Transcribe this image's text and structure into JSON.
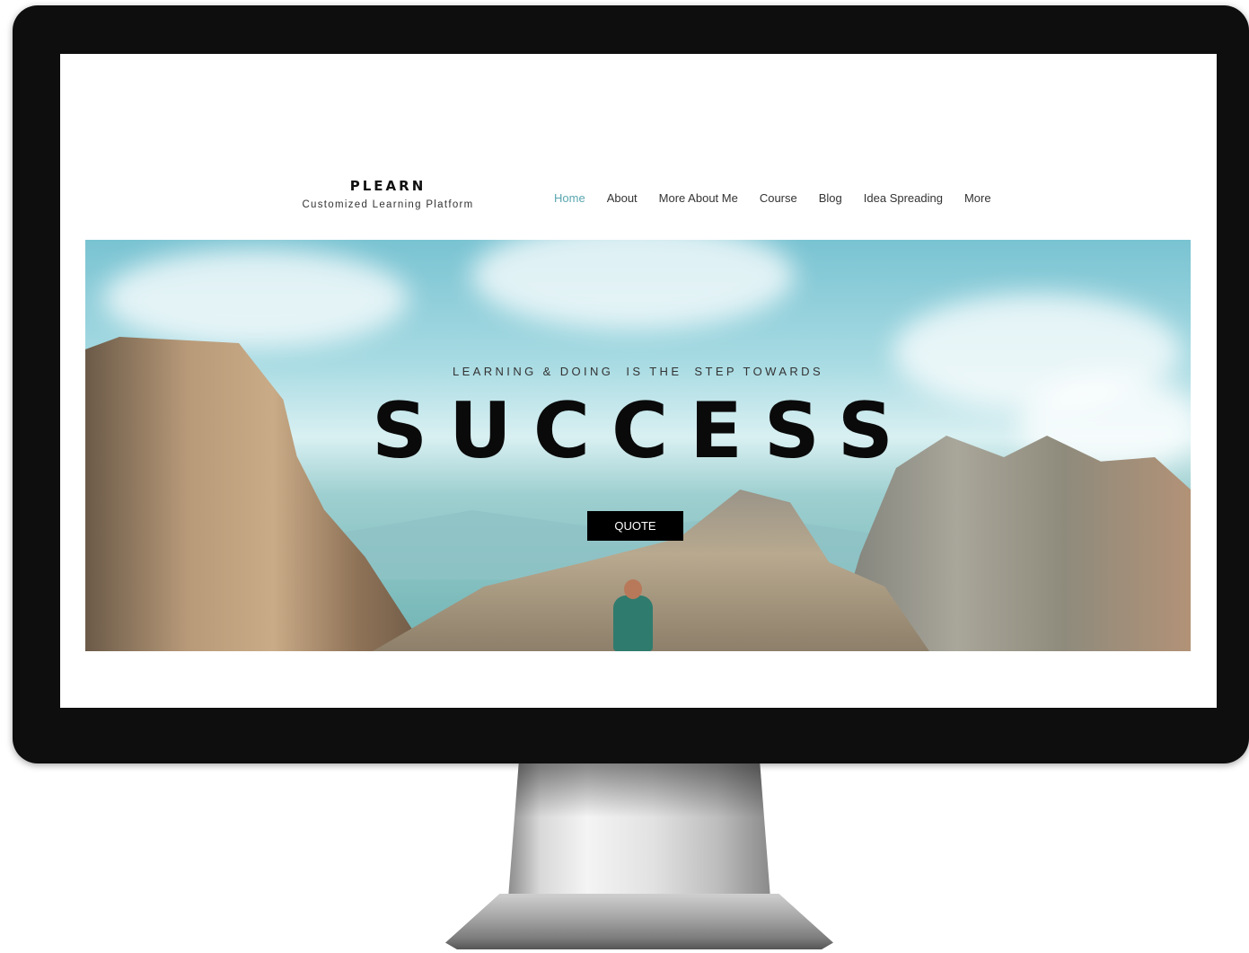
{
  "site": {
    "logo_title": "PLEARN",
    "logo_subtitle": "Customized Learning Platform"
  },
  "nav": {
    "items": [
      {
        "label": "Home",
        "active": true
      },
      {
        "label": "About"
      },
      {
        "label": "More About Me"
      },
      {
        "label": "Course"
      },
      {
        "label": "Blog"
      },
      {
        "label": "Idea Spreading"
      },
      {
        "label": "More"
      }
    ],
    "active_color": "#5aa6b0"
  },
  "hero": {
    "subtitle": "LEARNING & DOING  IS THE  STEP TOWARDS",
    "title": "SUCCESS",
    "button_label": "QUOTE"
  }
}
